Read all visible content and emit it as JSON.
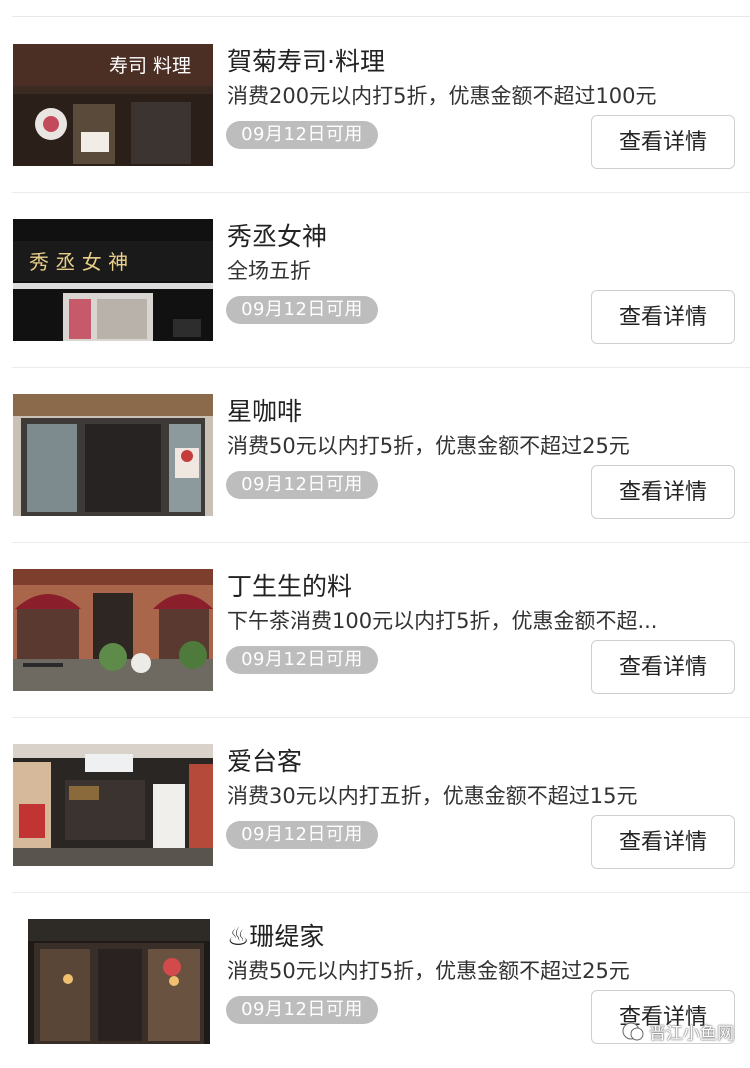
{
  "detail_button_label": "查看详情",
  "badge_text": "09月12日可用",
  "items": [
    {
      "name": "賀菊寿司·料理",
      "desc": "消费200元以内打5折，优惠金额不超过100元",
      "thumb_icon": "sushi-restaurant-storefront"
    },
    {
      "name": "秀丞女神",
      "desc": "全场五折",
      "thumb_icon": "hair-salon-storefront"
    },
    {
      "name": "星咖啡",
      "desc": "消费50元以内打5折，优惠金额不超过25元",
      "thumb_icon": "coffee-shop-storefront"
    },
    {
      "name": "丁生生的料",
      "desc": "下午茶消费100元以内打5折，优惠金额不超...",
      "thumb_icon": "tea-house-storefront"
    },
    {
      "name": "爱台客",
      "desc": "消费30元以内打五折，优惠金额不超过15元",
      "thumb_icon": "taiwanese-shop-storefront"
    },
    {
      "name": "♨珊缇家",
      "desc": "消费50元以内打5折，优惠金额不超过25元",
      "thumb_icon": "cafe-storefront"
    }
  ],
  "thumb_signs": {
    "sushi": "寿司 料理",
    "salon": "秀 丞 女 神"
  },
  "watermark": "晋江小鱼网",
  "colors": {
    "badge": "#bdbdbd",
    "divider": "#ebebeb",
    "button_border": "#cfcfcf"
  }
}
